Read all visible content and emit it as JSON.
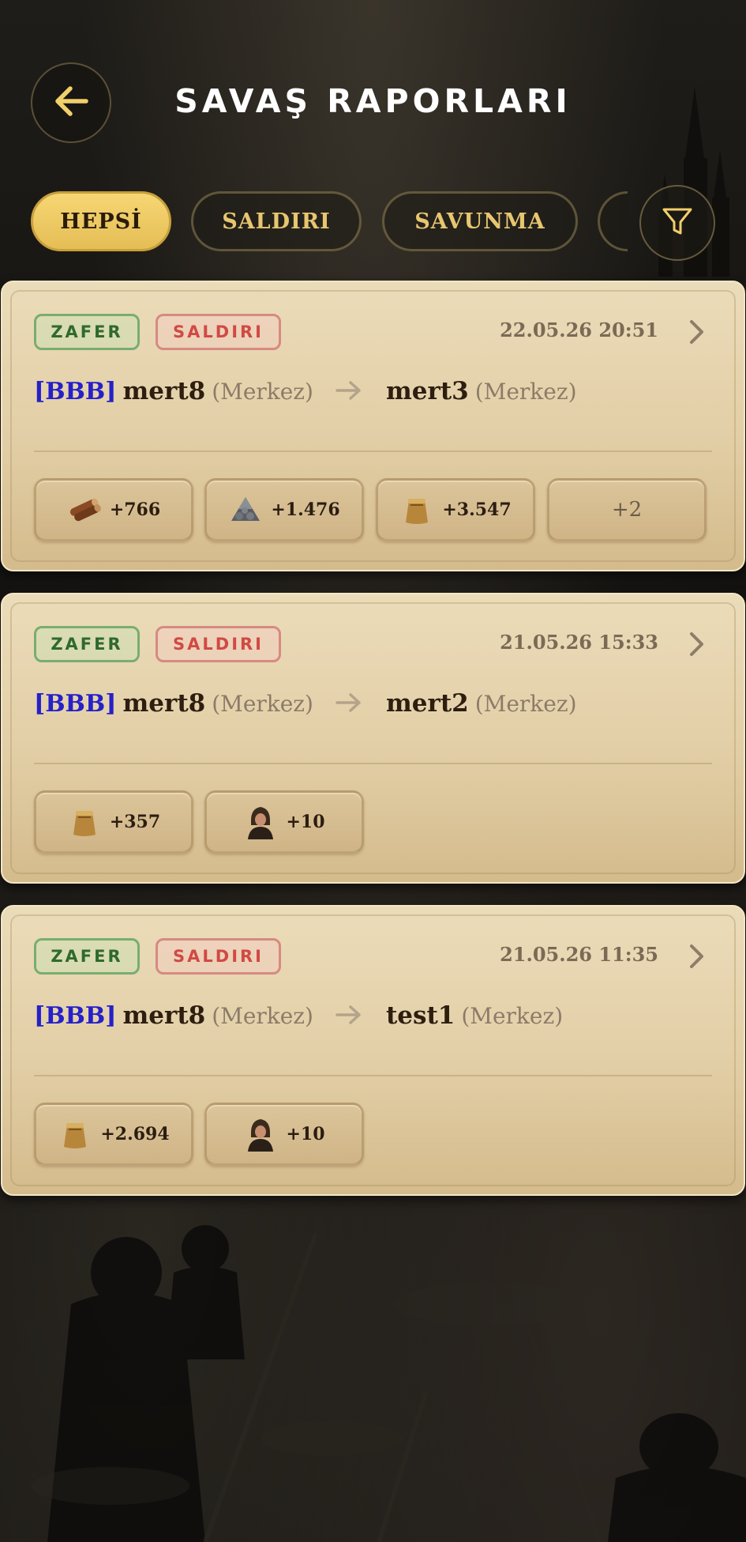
{
  "header": {
    "title": "SAVAŞ RAPORLARI"
  },
  "tabs": [
    {
      "label": "HEPSİ",
      "active": true
    },
    {
      "label": "SALDIRI",
      "active": false
    },
    {
      "label": "SAVUNMA",
      "active": false
    }
  ],
  "colors": {
    "accent": "#f1cf6a",
    "clan": "#2620c9",
    "win": "#2f6a2c",
    "attack": "#d04a44"
  },
  "reports": [
    {
      "result": "ZAFER",
      "type": "SALDIRI",
      "date": "22.05.26 20:51",
      "attacker_clan": "[BBB]",
      "attacker": "mert8",
      "attacker_location": "(Merkez)",
      "defender": "mert3",
      "defender_location": "(Merkez)",
      "resources": [
        {
          "icon": "wood-icon",
          "amount": "+766"
        },
        {
          "icon": "stone-icon",
          "amount": "+1.476"
        },
        {
          "icon": "grain-sack-icon",
          "amount": "+3.547"
        },
        {
          "icon": "more",
          "amount": "+2"
        }
      ]
    },
    {
      "result": "ZAFER",
      "type": "SALDIRI",
      "date": "21.05.26 15:33",
      "attacker_clan": "[BBB]",
      "attacker": "mert8",
      "attacker_location": "(Merkez)",
      "defender": "mert2",
      "defender_location": "(Merkez)",
      "resources": [
        {
          "icon": "grain-sack-icon",
          "amount": "+357"
        },
        {
          "icon": "villager-icon",
          "amount": "+10"
        }
      ]
    },
    {
      "result": "ZAFER",
      "type": "SALDIRI",
      "date": "21.05.26 11:35",
      "attacker_clan": "[BBB]",
      "attacker": "mert8",
      "attacker_location": "(Merkez)",
      "defender": "test1",
      "defender_location": "(Merkez)",
      "resources": [
        {
          "icon": "grain-sack-icon",
          "amount": "+2.694"
        },
        {
          "icon": "villager-icon",
          "amount": "+10"
        }
      ]
    }
  ]
}
